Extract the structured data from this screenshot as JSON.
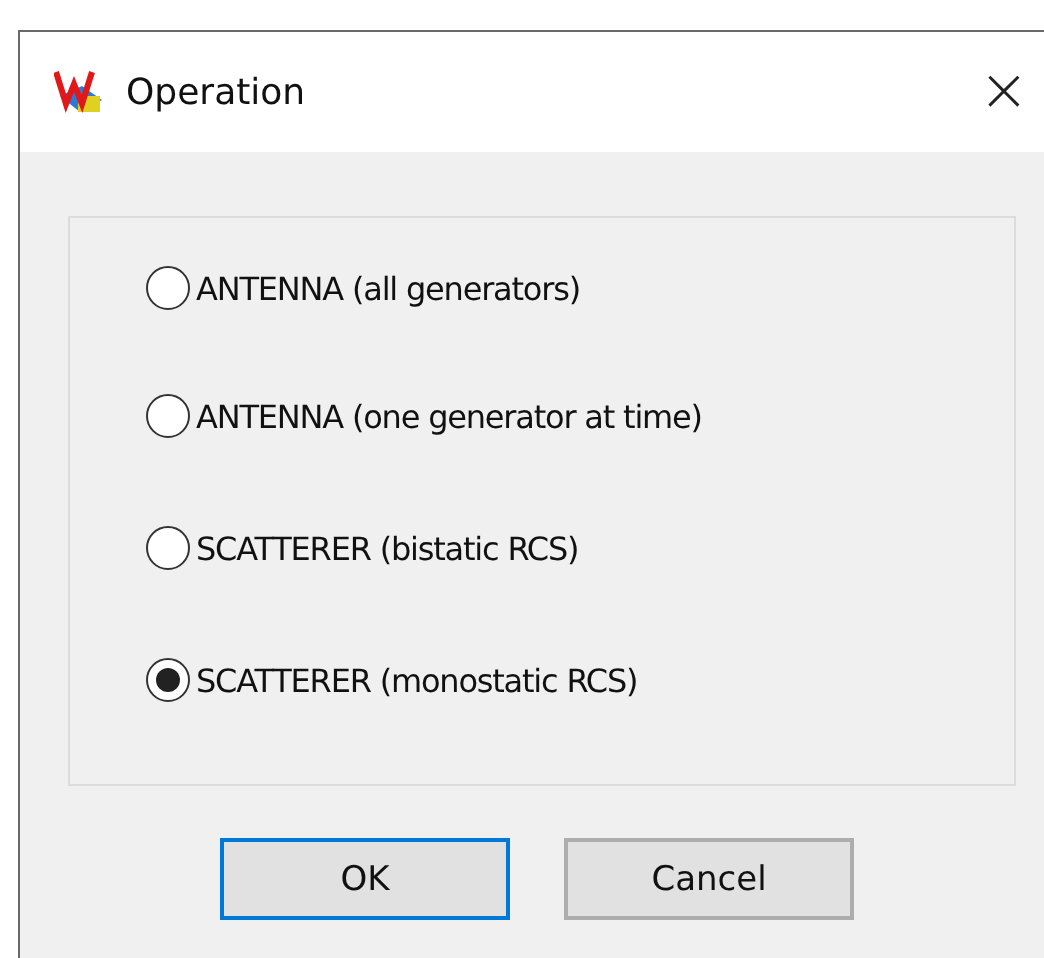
{
  "window": {
    "title": "Operation",
    "close": "×"
  },
  "options": [
    {
      "label": "ANTENNA (all generators)",
      "selected": false
    },
    {
      "label": "ANTENNA (one generator at time)",
      "selected": false
    },
    {
      "label": "SCATTERER (bistatic RCS)",
      "selected": false
    },
    {
      "label": "SCATTERER (monostatic RCS)",
      "selected": true
    }
  ],
  "buttons": [
    {
      "label": "OK",
      "focused": true
    },
    {
      "label": "Cancel",
      "focused": false
    }
  ]
}
